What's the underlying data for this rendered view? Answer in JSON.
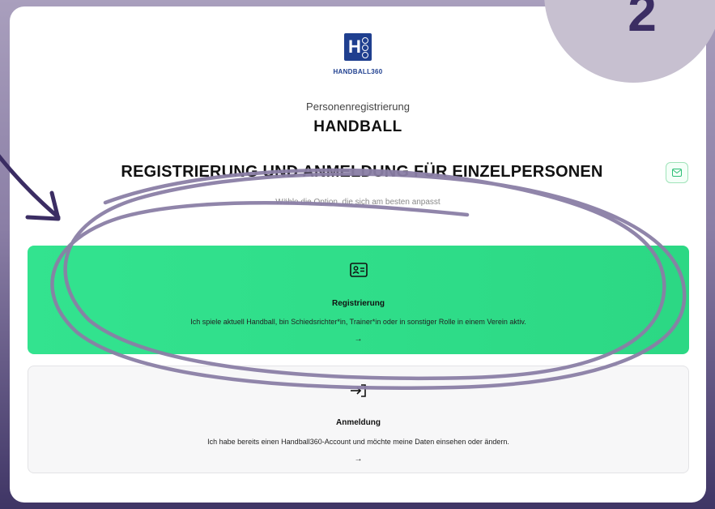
{
  "logo": {
    "text": "HANDBALL360"
  },
  "page": {
    "subtitle": "Personenregistrierung",
    "title": "HANDBALL",
    "heading": "REGISTRIERUNG UND ANMELDUNG FÜR EINZELPERSONEN",
    "hint": "Wähle die Option, die sich am besten anpasst"
  },
  "options": [
    {
      "name": "Registrierung",
      "description": "Ich spiele aktuell Handball, bin Schiedsrichter*in, Trainer*in oder in sonstiger Rolle in einem Verein aktiv.",
      "arrow": "→",
      "icon": "id-card-icon"
    },
    {
      "name": "Anmeldung",
      "description": "Ich habe bereits einen Handball360-Account und möchte meine Daten einsehen oder ändern.",
      "arrow": "→",
      "icon": "login-icon"
    }
  ],
  "overlay": {
    "number": "2"
  },
  "colors": {
    "accent_green": "#33e38f",
    "brand_blue": "#1f3f8f",
    "scribble": "#8a7ea5",
    "badge_bg": "#c7c0d0",
    "badge_number": "#3b2d63"
  }
}
